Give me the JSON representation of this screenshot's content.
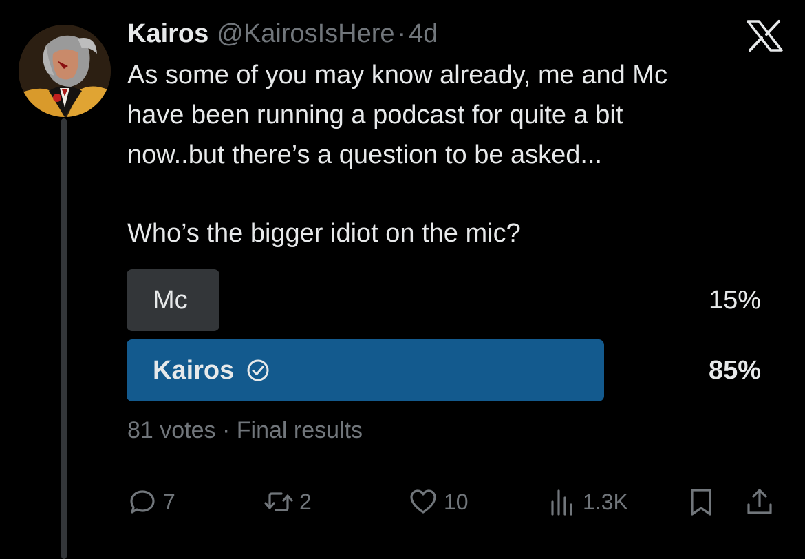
{
  "tweet": {
    "author_name": "Kairos",
    "handle": "@KairosIsHere",
    "separator": "·",
    "time": "4d",
    "text_lines": [
      "As some of you may know already, me and Mc",
      "have been running a podcast for quite a bit",
      "now..but there’s a question to be asked..."
    ],
    "question": "Who’s the bigger idiot on the mic?"
  },
  "poll": {
    "options": [
      {
        "label": "Mc",
        "percent_text": "15%",
        "share": 0.15,
        "winner": false,
        "bar_color": "#333639"
      },
      {
        "label": "Kairos",
        "percent_text": "85%",
        "share": 0.85,
        "winner": true,
        "bar_color": "#135a8e"
      }
    ],
    "votes": "81 votes",
    "separator": "·",
    "status": "Final results"
  },
  "actions": {
    "replies": "7",
    "reposts": "2",
    "likes": "10",
    "views": "1.3K"
  },
  "icons": {
    "logo": "x-logo-icon",
    "reply": "reply-icon",
    "repost": "repost-icon",
    "like": "heart-icon",
    "views": "views-icon",
    "bookmark": "bookmark-icon",
    "share": "share-icon",
    "winner": "check-circle-icon"
  },
  "colors": {
    "background": "#000000",
    "text": "#e7e9ea",
    "muted": "#71767b",
    "winner_bar": "#135a8e",
    "loser_bar": "#333639"
  }
}
